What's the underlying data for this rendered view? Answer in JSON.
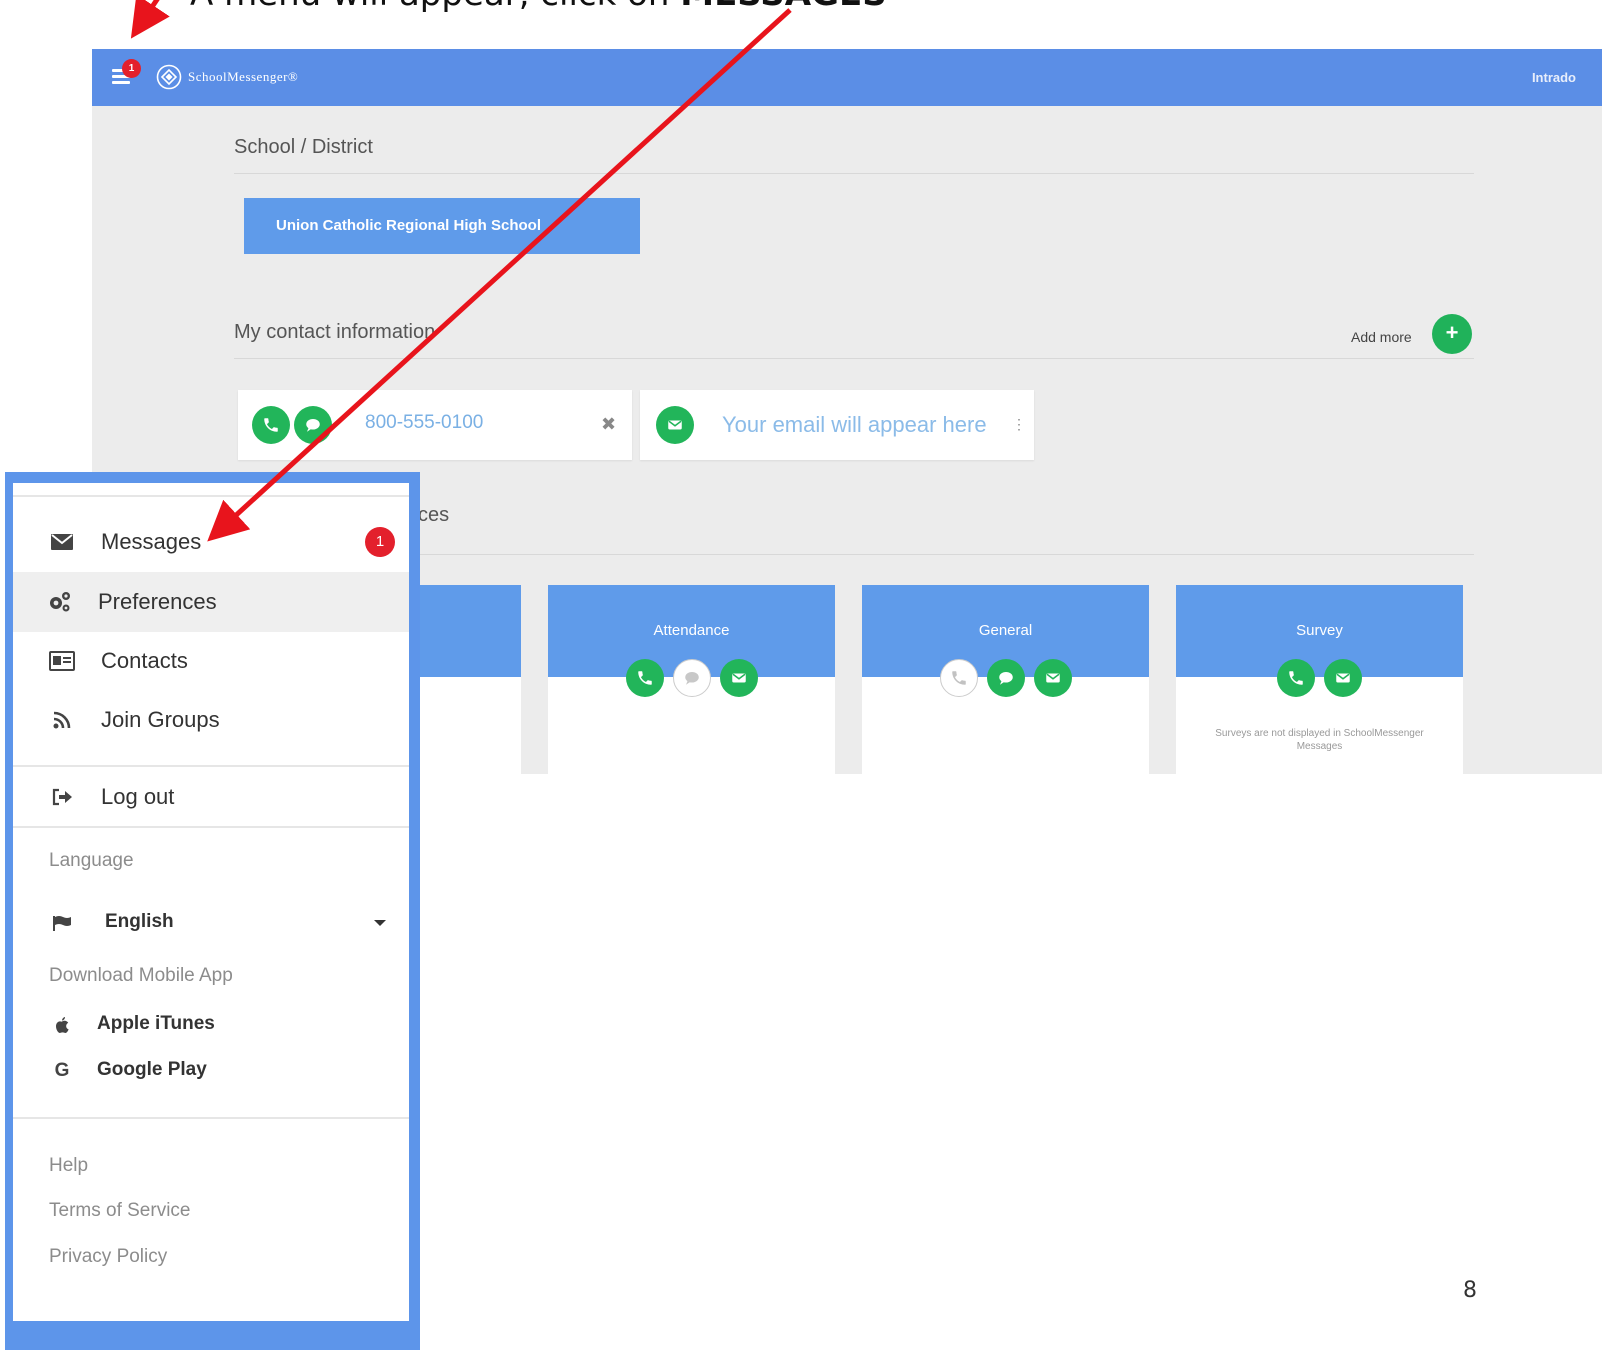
{
  "instruction": {
    "prefix": "A menu will appear, click on ",
    "emphasis": "MESSAGES"
  },
  "topbar": {
    "brand": "SchoolMessenger®",
    "notification_count": "1",
    "partner": "Intrado"
  },
  "school_section": {
    "title": "School / District",
    "school_name": "Union Catholic Regional High School"
  },
  "contact_section": {
    "title": "My contact information",
    "add_more_label": "Add more",
    "add_icon": "+",
    "phone": "800-555-0100",
    "remove_icon": "✖",
    "email_placeholder": "Your email will appear here",
    "email_more": "⋮"
  },
  "preferences_section": {
    "title_fragment": "ces"
  },
  "categories": [
    {
      "name": "Attendance",
      "icons": [
        "phone-icon",
        "sms-icon",
        "email-icon"
      ]
    },
    {
      "name": "General",
      "icons": [
        "phone-icon",
        "sms-icon",
        "email-icon"
      ]
    },
    {
      "name": "Survey",
      "icons": [
        "phone-icon",
        "email-icon"
      ],
      "note": "Surveys are not displayed in SchoolMessenger Messages"
    }
  ],
  "menu": {
    "items": [
      {
        "label": "Messages",
        "badge": "1"
      },
      {
        "label": "Preferences"
      },
      {
        "label": "Contacts"
      },
      {
        "label": "Join Groups"
      },
      {
        "label": "Log out"
      }
    ],
    "language_heading": "Language",
    "language_value": "English",
    "download_heading": "Download Mobile App",
    "apps": [
      "Apple iTunes",
      "Google Play"
    ],
    "google_glyph": "G",
    "footer_links": [
      "Help",
      "Terms of Service",
      "Privacy Policy"
    ]
  },
  "page_number": "8",
  "colors": {
    "topbar": "#5b8ee6",
    "card_blue": "#5f9bea",
    "green": "#22b55a",
    "badge_red": "#e3202c",
    "arrow_red": "#e8141c"
  }
}
